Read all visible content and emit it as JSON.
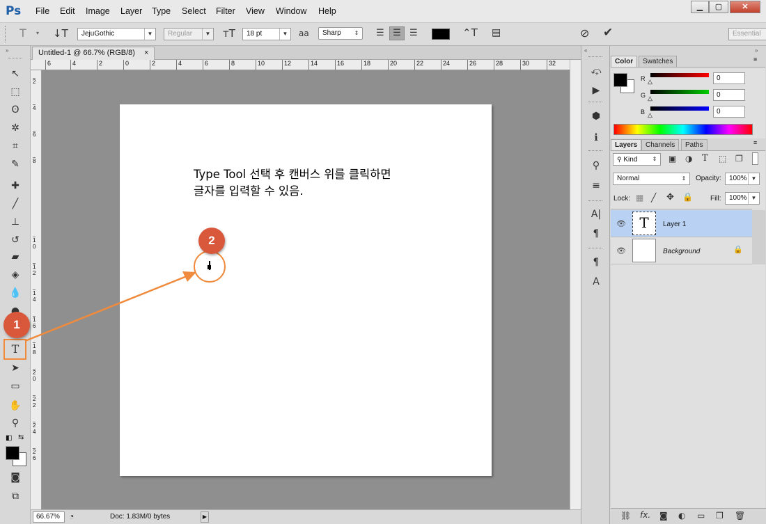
{
  "app": {
    "logo": "Ps",
    "menu": [
      "File",
      "Edit",
      "Image",
      "Layer",
      "Type",
      "Select",
      "Filter",
      "View",
      "Window",
      "Help"
    ]
  },
  "options": {
    "font_family": "JejuGothic",
    "font_style": "Regular",
    "font_size": "18 pt",
    "antialias_icon": "aa",
    "antialias": "Sharp",
    "workspace": "Essential"
  },
  "document": {
    "tab_title": "Untitled-1 @ 66.7% (RGB/8)",
    "tab_close": "×",
    "ruler_top": [
      "6",
      "4",
      "2",
      "0",
      "2",
      "4",
      "6",
      "8",
      "10",
      "12",
      "14",
      "16",
      "18",
      "20",
      "22",
      "24",
      "26",
      "28",
      "30",
      "32"
    ],
    "ruler_left": [
      "2",
      "4",
      "6",
      "8",
      "1\n0",
      "1\n2",
      "1\n4",
      "1\n6",
      "1\n8",
      "2\n0",
      "2\n2",
      "2\n4",
      "2\n6"
    ],
    "instruction_line1": "Type Tool 선택 후 캔버스 위를 클릭하면",
    "instruction_line2": "글자를 입력할 수 있음.",
    "zoom": "66.67%",
    "doc_info": "Doc: 1.83M/0 bytes"
  },
  "callouts": {
    "one": "1",
    "two": "2"
  },
  "colors": {
    "accent": "#d9573a",
    "arrow": "#f08a3c"
  },
  "color_panel": {
    "tabs": [
      "Color",
      "Swatches"
    ],
    "channels": [
      {
        "label": "R",
        "value": "0"
      },
      {
        "label": "G",
        "value": "0"
      },
      {
        "label": "B",
        "value": "0"
      }
    ]
  },
  "layers_panel": {
    "tabs": [
      "Layers",
      "Channels",
      "Paths"
    ],
    "filter_kind": "Kind",
    "blend_mode": "Normal",
    "opacity_label": "Opacity:",
    "opacity": "100%",
    "lock_label": "Lock:",
    "fill_label": "Fill:",
    "fill": "100%",
    "layers": [
      {
        "name": "Layer 1",
        "thumb": "T",
        "selected": true
      },
      {
        "name": "Background",
        "locked": true,
        "selected": false
      }
    ],
    "footer_fx": "fx."
  }
}
